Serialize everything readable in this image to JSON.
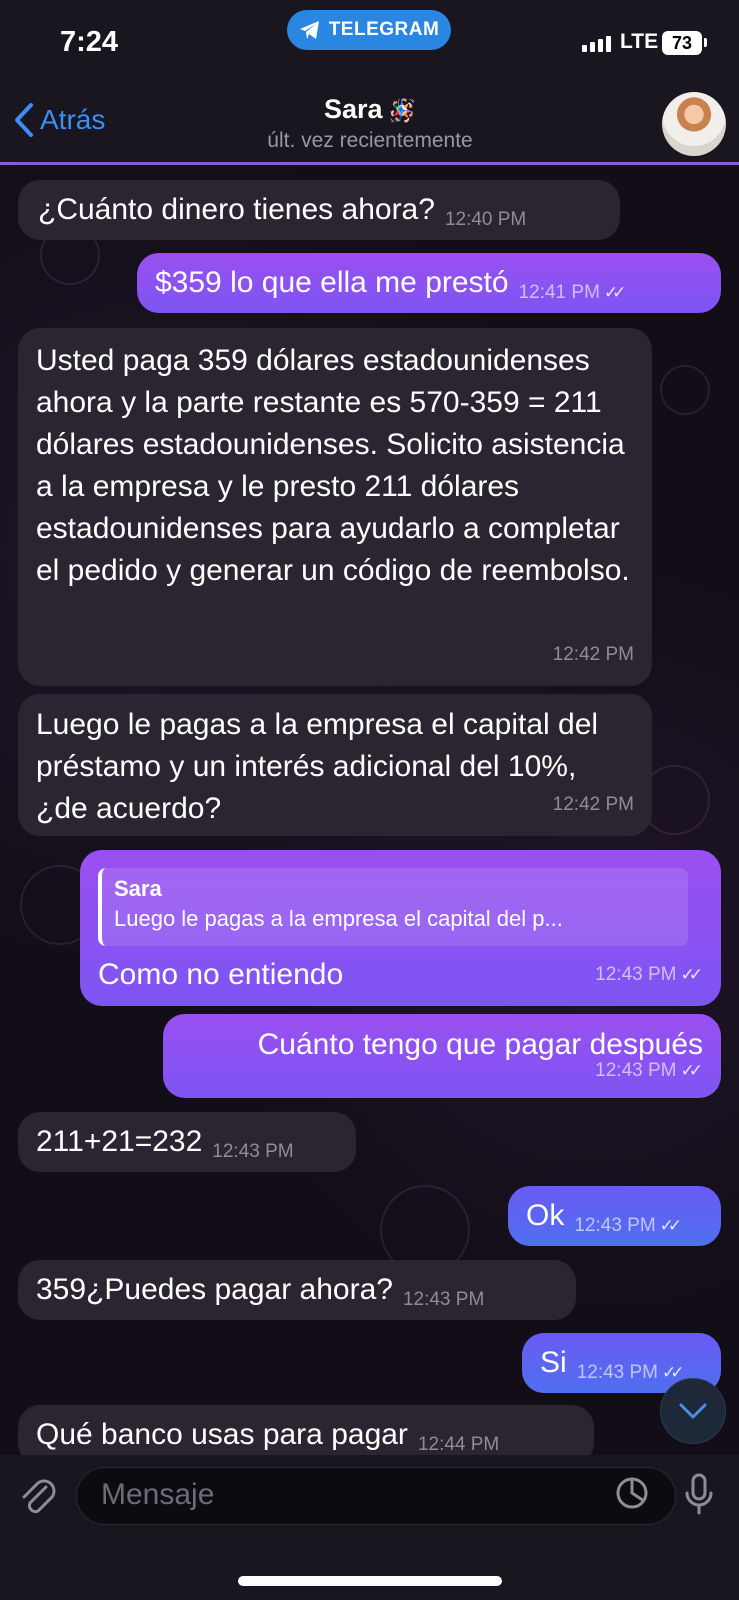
{
  "status_bar": {
    "time": "7:24",
    "app_badge": "TELEGRAM",
    "network": "LTE",
    "battery": "73"
  },
  "header": {
    "back_label": "Atrás",
    "contact_name": "Sara",
    "contact_emoji": "🪅",
    "contact_status": "últ. vez recientemente"
  },
  "messages": [
    {
      "side": "in",
      "text": "¿Cuánto dinero tienes ahora?",
      "time": "12:40 PM"
    },
    {
      "side": "out",
      "text": "$359 lo que ella me prestó",
      "time": "12:41 PM",
      "read": true
    },
    {
      "side": "in",
      "text": "Usted paga 359 dólares estadounidenses ahora y la parte restante es 570-359 = 211 dólares estadounidenses. Solicito asistencia a la empresa y le presto 211 dólares estadounidenses para ayudarlo a completar el pedido y generar un código de reembolso.",
      "time": "12:42 PM"
    },
    {
      "side": "in",
      "text": "Luego le pagas a la empresa el capital del préstamo y un interés adicional del 10%, ¿de acuerdo?",
      "time": "12:42 PM"
    },
    {
      "side": "out",
      "reply_to_name": "Sara",
      "reply_to_text": "Luego le pagas a la empresa el capital del p...",
      "text": "Como no entiendo",
      "time": "12:43 PM",
      "read": true
    },
    {
      "side": "out",
      "text": "Cuánto tengo que pagar después",
      "time": "12:43 PM",
      "read": true
    },
    {
      "side": "in",
      "text": "211+21=232",
      "time": "12:43 PM"
    },
    {
      "side": "out",
      "text": "Ok",
      "time": "12:43 PM",
      "read": true
    },
    {
      "side": "in",
      "text": "359¿Puedes pagar ahora?",
      "time": "12:43 PM"
    },
    {
      "side": "out",
      "text": "Si",
      "time": "12:43 PM",
      "read": true
    },
    {
      "side": "in",
      "text": "Qué banco usas para pagar",
      "time": "12:44 PM"
    }
  ],
  "composer": {
    "placeholder": "Mensaje"
  },
  "colors": {
    "accent_blue": "#3b8ef5",
    "outgoing_bubble": "#8a4ff0",
    "incoming_bubble": "#2a2530"
  },
  "icons": [
    "telegram-icon",
    "back-chevron-icon",
    "read-check-icon",
    "chevron-down-icon",
    "paperclip-icon",
    "sticker-icon",
    "microphone-icon"
  ]
}
